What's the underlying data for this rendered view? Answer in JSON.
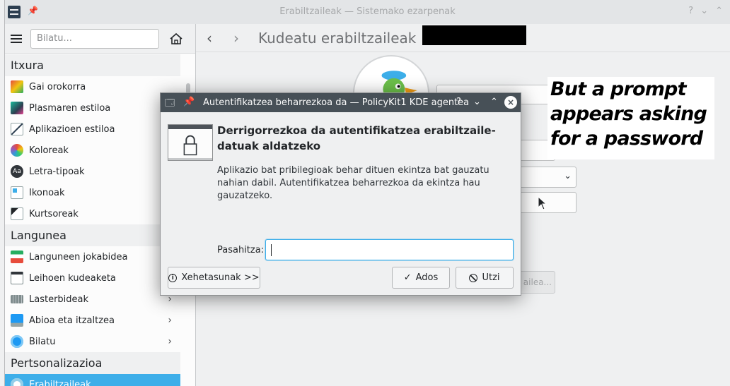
{
  "window": {
    "title": "Erabiltzaileak — Sistemako ezarpenak",
    "help_glyph": "?",
    "minimize_glyph": "⌄",
    "maximize_glyph": "⌃"
  },
  "sidebar": {
    "search_placeholder": "Bilatu...",
    "categories": [
      {
        "label": "Itxura",
        "items": [
          {
            "label": "Gai orokorra"
          },
          {
            "label": "Plasmaren estiloa"
          },
          {
            "label": "Aplikazioen estiloa"
          },
          {
            "label": "Koloreak"
          },
          {
            "label": "Letra-tipoak"
          },
          {
            "label": "Ikonoak"
          },
          {
            "label": "Kurtsoreak"
          }
        ]
      },
      {
        "label": "Langunea",
        "items": [
          {
            "label": "Languneen jokabidea"
          },
          {
            "label": "Leihoen kudeaketa"
          },
          {
            "label": "Lasterbideak"
          },
          {
            "label": "Abioa eta itzaltzea"
          },
          {
            "label": "Bilatu"
          }
        ]
      },
      {
        "label": "Pertsonalizazioa",
        "items": [
          {
            "label": "Erabiltzaileak"
          }
        ]
      }
    ]
  },
  "content": {
    "header_title": "Kudeatu erabiltzaileak",
    "background_button_partial": "ailea..."
  },
  "annotation": {
    "lines": [
      "But a prompt",
      "appears asking",
      "for a password"
    ]
  },
  "dialog": {
    "title": "Autentifikatzea beharrezkoa da — PolicyKit1 KDE agentea",
    "help_glyph": "?",
    "minimize_glyph": "⌄",
    "maximize_glyph": "⌃",
    "close_glyph": "×",
    "heading": "Derrigorrezkoa da autentifikatzea erabiltzaile-datuak aldatzeko",
    "body": "Aplikazio bat pribilegioak behar dituen ekintza bat gauzatu nahian dabil. Autentifikatzea beharrezkoa da ekintza hau gauzatzeko.",
    "password_label": "Pasahitza:",
    "password_value": "",
    "details_button": "Xehetasunak >>",
    "ok_button": "Ados",
    "cancel_button": "Utzi"
  },
  "colors": {
    "accent": "#3daee9",
    "dialog_titlebar": "#475057",
    "window_bg": "#eff0f1"
  }
}
